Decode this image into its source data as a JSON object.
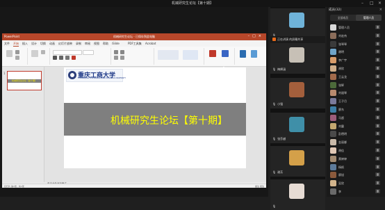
{
  "window": {
    "title": "机械研究生论坛【第十期】"
  },
  "ppt": {
    "window_title": "机械研究生论坛 - 已保存到此电脑",
    "app_label": "PowerPoint",
    "ribbon_tabs": [
      "文件",
      "开始",
      "插入",
      "设计",
      "切换",
      "动画",
      "幻灯片放映",
      "录制",
      "审阅",
      "视图",
      "帮助",
      "iSlide",
      "PDF工具集",
      "Acrobat"
    ],
    "active_tab": "开始",
    "slide_number": "1",
    "thumb_title": "机械研究生论坛【第十期】",
    "slide_logo_text": "重庆工商大学",
    "slide_logo_sub": "CHONGQING TECHNOLOGY AND BUSINESS UNIVERSITY",
    "slide_title": "机械研究生论坛【第十期】",
    "notes_placeholder": "单击此处添加备注",
    "status_left": "幻灯片 第1张，共1张",
    "status_right": "备注  批注"
  },
  "presenter": {
    "name": "正在讲演  的屏幕共享"
  },
  "video_tiles": [
    {
      "name": "",
      "color": "#6fb3d9"
    },
    {
      "name": "梅卿涵",
      "color": "#c7c0b6"
    },
    {
      "name": "小强",
      "color": "#a45f3c"
    },
    {
      "name": "张芬越",
      "color": "#3f8fa8"
    },
    {
      "name": "谢芳",
      "color": "#d4a049"
    },
    {
      "name": "",
      "color": "#e7dcd4"
    }
  ],
  "members": {
    "header": "成员(32)",
    "tabs": [
      "全部成员",
      "管理人员"
    ],
    "active_tab": "管理人员",
    "list": [
      {
        "name": "管理人员",
        "color": "#d8d8d8"
      },
      {
        "name": "刘宏伟",
        "color": "#8b6d5a"
      },
      {
        "name": "张琴琴",
        "color": "#3a3a3a"
      },
      {
        "name": "谢明",
        "color": "#6fa4c8"
      },
      {
        "name": "李广宇",
        "color": "#d79c6a"
      },
      {
        "name": "胡欣",
        "color": "#cfae8a"
      },
      {
        "name": "王云龙",
        "color": "#a36b4b"
      },
      {
        "name": "张辉",
        "color": "#4c6a3a"
      },
      {
        "name": "刘道琴",
        "color": "#b88a6e"
      },
      {
        "name": "王子月",
        "color": "#7a7a9a"
      },
      {
        "name": "廖东",
        "color": "#3d7fa6"
      },
      {
        "name": "马超",
        "color": "#9c5d7a"
      },
      {
        "name": "刘震",
        "color": "#c4a870"
      },
      {
        "name": "彭德明",
        "color": "#4a4a4a"
      },
      {
        "name": "金丽娜",
        "color": "#c9b9a8"
      },
      {
        "name": "胡佳",
        "color": "#e0c7b4"
      },
      {
        "name": "黄婷婷",
        "color": "#a38b71"
      },
      {
        "name": "杨帆",
        "color": "#5e7b9a"
      },
      {
        "name": "廖旭",
        "color": "#8b5a3c"
      },
      {
        "name": "吴欣",
        "color": "#d2b48c"
      },
      {
        "name": "李",
        "color": "#6a6a6a"
      }
    ]
  }
}
